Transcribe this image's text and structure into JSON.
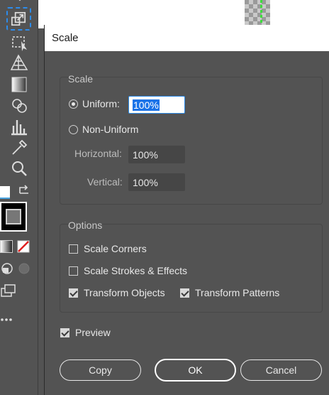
{
  "dialog": {
    "title": "Scale",
    "scale_group": {
      "title": "Scale",
      "uniform_label": "Uniform:",
      "uniform_value": "100%",
      "nonuniform_label": "Non-Uniform",
      "horizontal_label": "Horizontal:",
      "horizontal_value": "100%",
      "vertical_label": "Vertical:",
      "vertical_value": "100%"
    },
    "options_group": {
      "title": "Options",
      "scale_corners": "Scale Corners",
      "scale_strokes": "Scale Strokes & Effects",
      "transform_objects": "Transform Objects",
      "transform_patterns": "Transform Patterns"
    },
    "preview_label": "Preview",
    "buttons": {
      "copy": "Copy",
      "ok": "OK",
      "cancel": "Cancel"
    }
  },
  "tools": [
    "arrow-icon",
    "scale-tool-icon",
    "free-transform-icon",
    "perspective-grid-icon",
    "gradient-icon",
    "shape-builder-icon",
    "graph-icon",
    "eyedropper-icon",
    "zoom-icon",
    "swap-colors-icon",
    "fill-swatch",
    "stroke-swatch",
    "none-color-icon",
    "draw-mode-icon",
    "screen-mode-icon",
    "more-tools-icon"
  ],
  "colors": {
    "panel_bg": "#535353",
    "accent": "#2d8ceb",
    "focus_highlight": "#1a73e8"
  }
}
